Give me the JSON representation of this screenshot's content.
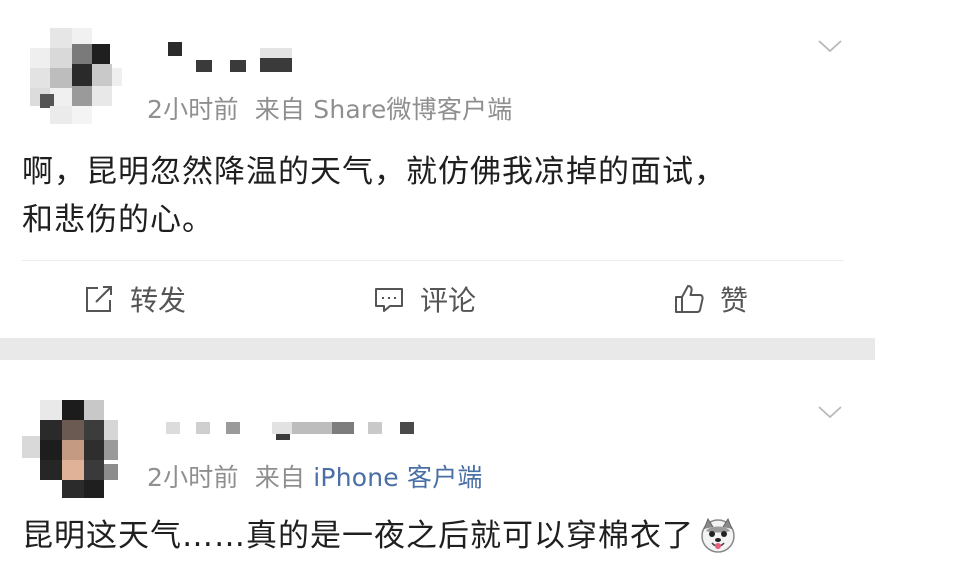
{
  "posts": [
    {
      "time": "2小时前",
      "source_prefix": "来自",
      "source": "Share微博客户端",
      "content_line1": "啊，昆明忽然降温的天气，就仿佛我凉掉的面试，",
      "content_line2": "和悲伤的心。",
      "actions": {
        "repost_label": "转发",
        "comment_label": "评论",
        "like_label": "赞"
      }
    },
    {
      "time": "2小时前",
      "source_prefix": "来自",
      "source": "iPhone 客户端",
      "content_text": "昆明这天气……真的是一夜之后就可以穿棉衣了",
      "emoji": "dog-emoji"
    }
  ],
  "colors": {
    "meta_gray": "#8f8f8f",
    "link_blue": "#4a6fa5",
    "separator_gray": "#e9e9e9"
  },
  "icons": [
    "chevron-down-icon",
    "repost-icon",
    "comment-icon",
    "like-icon",
    "dog-emoji"
  ]
}
